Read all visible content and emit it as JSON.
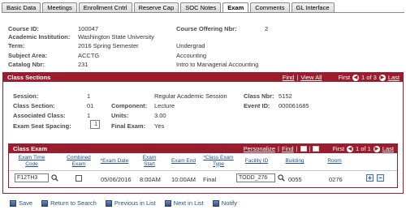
{
  "tabs": [
    "Basic Data",
    "Meetings",
    "Enrollment Cntrl",
    "Reserve Cap",
    "SOC Notes",
    "Exam",
    "Comments",
    "GL Interface"
  ],
  "active_tab": "Exam",
  "header": {
    "course_id_label": "Course ID:",
    "course_id": "100047",
    "offering_label": "Course Offering Nbr:",
    "offering": "2",
    "institution_label": "Academic Institution:",
    "institution": "Washington State University",
    "term_label": "Term:",
    "term": "2016 Spring Semester",
    "term_extra": "Undergrad",
    "subject_label": "Subject Area:",
    "subject": "ACCTG",
    "subject_desc": "Accounting",
    "catalog_label": "Catalog Nbr:",
    "catalog": "231",
    "catalog_desc": "Intro to Managerial Accounting"
  },
  "class_sections": {
    "title": "Class Sections",
    "find": "Find",
    "view_all": "View All",
    "first": "First",
    "range": "1 of 3",
    "last": "Last",
    "session_label": "Session:",
    "session": "1",
    "session_desc": "Regular Academic Session",
    "class_nbr_label": "Class Nbr:",
    "class_nbr": "5152",
    "class_section_label": "Class Section:",
    "class_section": "01",
    "component_label": "Component:",
    "component": "Lecture",
    "event_id_label": "Event ID:",
    "event_id": "000061685",
    "assoc_label": "Associated Class:",
    "assoc": "1",
    "units_label": "Units:",
    "units": "3.00",
    "spacing_label": "Exam Seat Spacing:",
    "spacing": "1",
    "final_label": "Final Exam:",
    "final": "Yes"
  },
  "class_exam": {
    "title": "Class Exam",
    "personalize": "Personalize",
    "find": "Find",
    "first": "First",
    "range": "1 of 1",
    "last": "Last",
    "columns": [
      "Exam Time Code",
      "Combined Exam",
      "*Exam Date",
      "Exam Start",
      "Exam End",
      "*Class Exam Type",
      "Facility ID",
      "Building",
      "Room"
    ],
    "row": {
      "time_code": "F12TH3",
      "exam_date": "05/06/2016",
      "start": "8:00AM",
      "end": "10:00AM",
      "type": "Final",
      "facility": "TODD_276",
      "building": "0055",
      "room": "0276"
    }
  },
  "buttons": {
    "save": "Save",
    "return": "Return to Search",
    "prev": "Previous in List",
    "next": "Next in List",
    "notify": "Notify"
  }
}
